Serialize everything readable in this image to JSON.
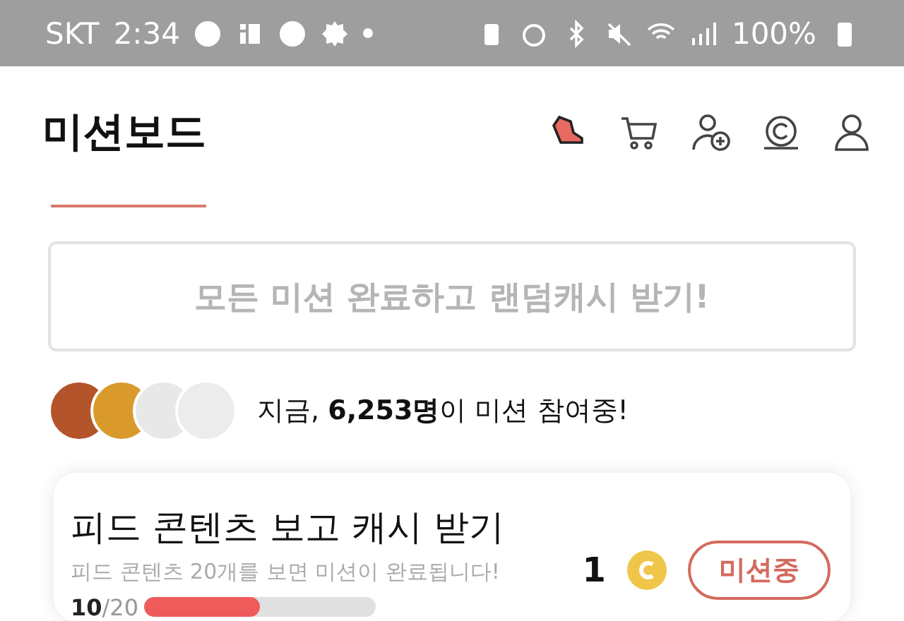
{
  "status_bar": {
    "carrier": "SKT",
    "time": "2:34",
    "battery": "100%"
  },
  "header": {
    "title": "미션보드"
  },
  "banner": {
    "text": "모든 미션 완료하고 랜덤캐시 받기!"
  },
  "participants": {
    "text": "지금, **6,253명**이 미션 참여중!"
  },
  "missions": [
    {
      "title": "피드 콘텐츠 보고 캐시 받기",
      "description": "피드 콘텐츠 20개를 보면 미션이 완료됩니다!",
      "reward": "1",
      "button": "미션중",
      "progress_current": "10",
      "progress_total": "/20",
      "level": 0.5
    }
  ]
}
